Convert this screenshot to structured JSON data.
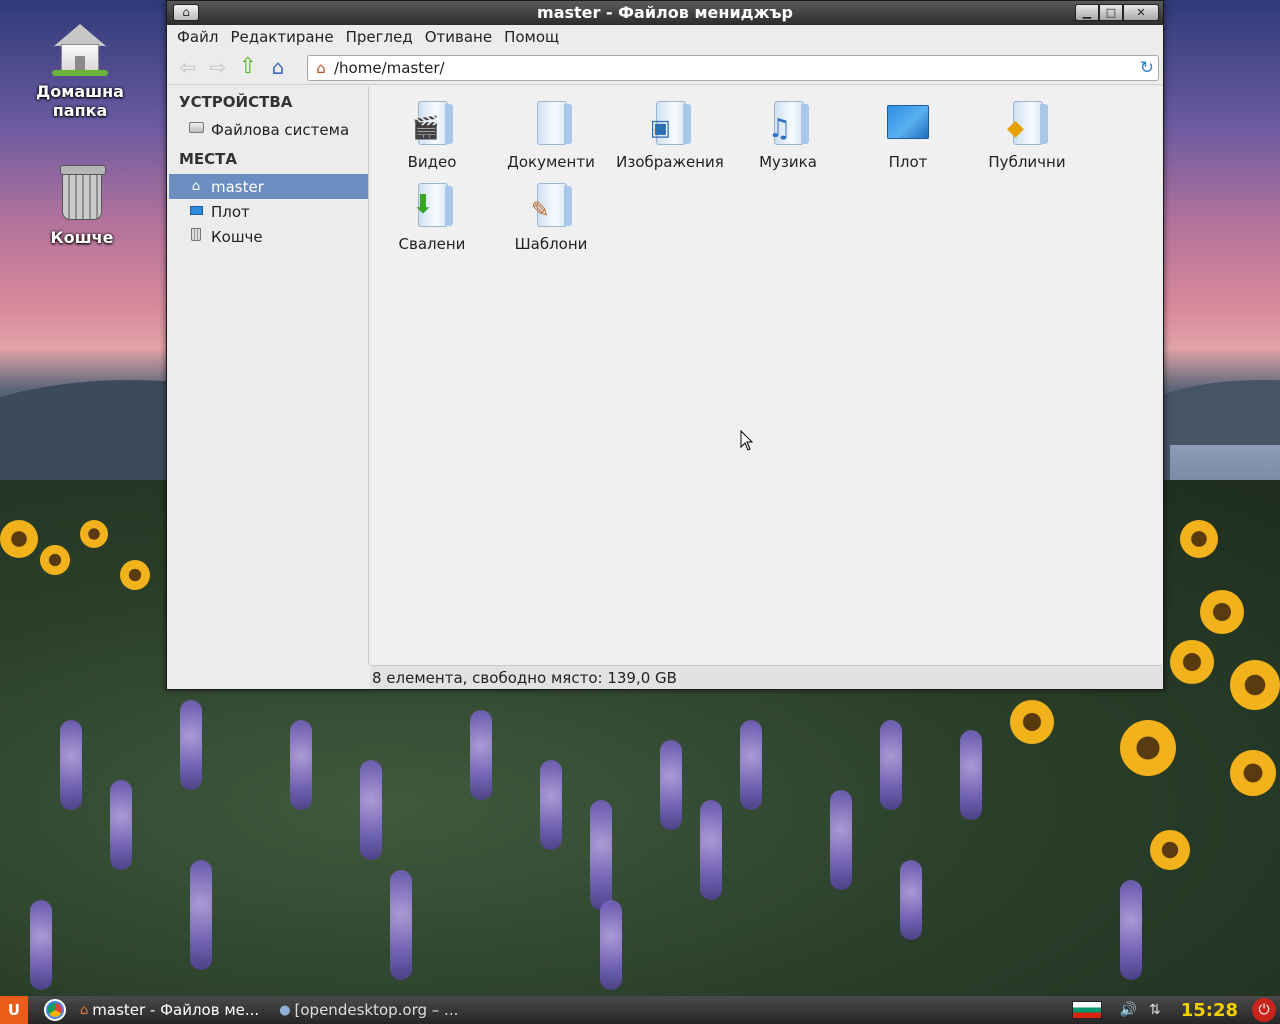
{
  "window": {
    "title": "master - Файлов мениджър"
  },
  "menubar": {
    "items": [
      "Файл",
      "Редактиране",
      "Преглед",
      "Отиване",
      "Помощ"
    ]
  },
  "location": {
    "path": "/home/master/"
  },
  "sidebar": {
    "devices_heading": "УСТРОЙСТВА",
    "devices": [
      {
        "label": "Файлова система",
        "icon": "drive-icon"
      }
    ],
    "places_heading": "МЕСТА",
    "places": [
      {
        "label": "master",
        "icon": "home-icon",
        "selected": true
      },
      {
        "label": "Плот",
        "icon": "desktop-icon"
      },
      {
        "label": "Кошче",
        "icon": "trash-icon"
      }
    ]
  },
  "files": [
    {
      "label": "Видео",
      "icon": "video-folder-icon"
    },
    {
      "label": "Документи",
      "icon": "documents-folder-icon"
    },
    {
      "label": "Изображения",
      "icon": "pictures-folder-icon"
    },
    {
      "label": "Музика",
      "icon": "music-folder-icon"
    },
    {
      "label": "Плот",
      "icon": "desktop-folder-icon"
    },
    {
      "label": "Публични",
      "icon": "public-folder-icon"
    },
    {
      "label": "Свалени",
      "icon": "downloads-folder-icon"
    },
    {
      "label": "Шаблони",
      "icon": "templates-folder-icon"
    }
  ],
  "statusbar": {
    "text": "8 елемента, свободно място: 139,0 GB"
  },
  "desktop": {
    "home_label": "Домашна папка",
    "trash_label": "Кошче"
  },
  "taskbar": {
    "tasks": [
      {
        "label": "master - Файлов ме...",
        "active": true
      },
      {
        "label": "[opendesktop.org – ...",
        "active": false
      }
    ],
    "clock": "15:28"
  },
  "colors": {
    "selection": "#6a8ec0",
    "clock": "#f5d000",
    "titlebar": "#2c2c2c"
  }
}
